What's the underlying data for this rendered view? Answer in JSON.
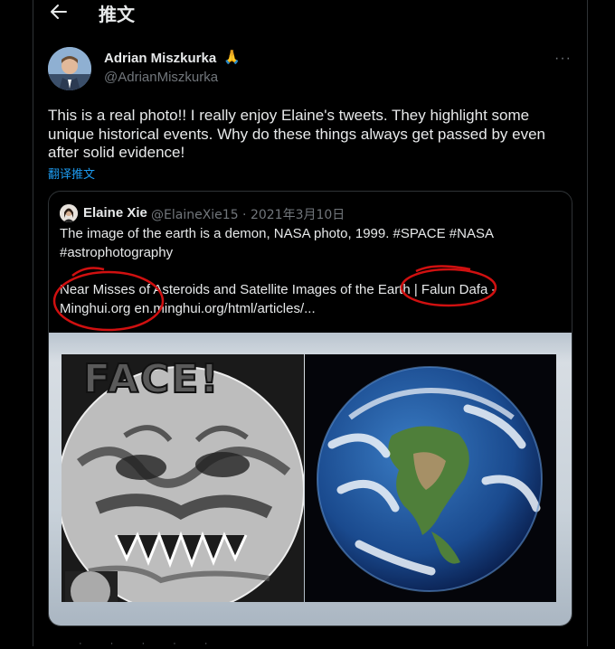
{
  "header": {
    "title": "推文",
    "back_icon": "arrow-left-icon"
  },
  "tweet": {
    "display_name": "Adrian Miszkurka",
    "emoji": "🙏",
    "handle": "@AdrianMiszkurka",
    "text": "This is a real photo!! I really enjoy Elaine's tweets. They highlight some unique historical events. Why do these things always get passed by even after solid evidence!",
    "translate": "翻译推文",
    "more": "···"
  },
  "quote": {
    "display_name": "Elaine Xie",
    "meta": "@ElaineXie15 · 2021年3月10日",
    "text": "The image of the earth is a demon, NASA photo, 1999. #SPACE #NASA #astrophotography",
    "link_text": "Near Misses of Asteroids and Satellite Images of the Earth | Falun Dafa - Minghui.org en.minghui.org/html/articles/...",
    "media_caption": "FACE!"
  },
  "colors": {
    "background": "#000000",
    "text": "#e7e9ea",
    "muted": "#71767b",
    "link": "#1d9bf0",
    "annotation": "#d01010"
  }
}
